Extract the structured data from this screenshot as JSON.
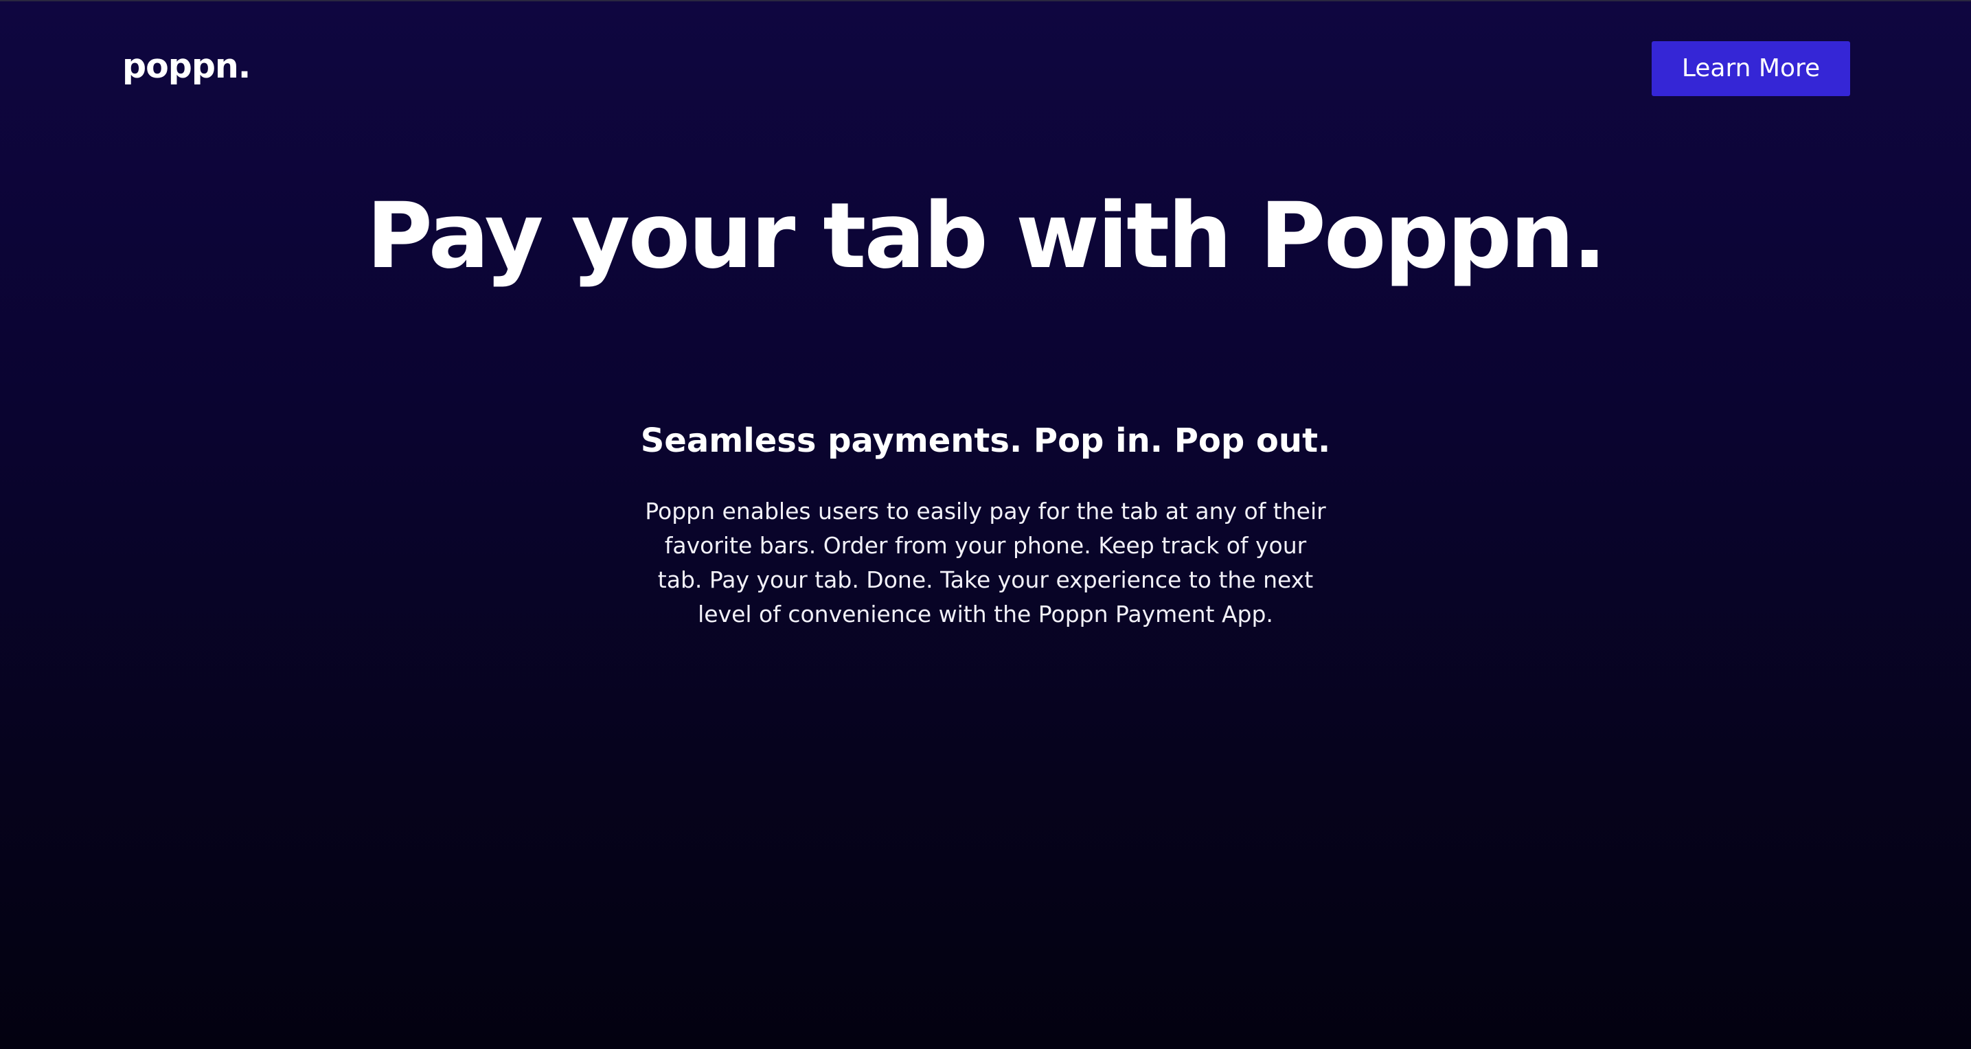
{
  "header": {
    "logo_text": "poppn.",
    "cta_label": "Learn More"
  },
  "hero": {
    "title": "Pay your tab with Poppn.",
    "subtitle": "Seamless payments. Pop in. Pop out.",
    "description": "Poppn enables users to easily pay for the tab at any of their favorite bars. Order from your phone. Keep track of your tab. Pay your tab. Done. Take your experience to the next level of convenience with the Poppn Payment App."
  },
  "colors": {
    "background_top": "#0f0640",
    "background_bottom": "#030110",
    "accent": "#3526d6",
    "text": "#ffffff"
  }
}
